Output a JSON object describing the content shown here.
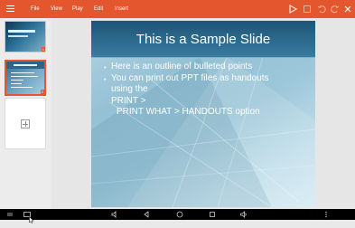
{
  "toolbar": {
    "menu_items": [
      "File",
      "View",
      "Play",
      "Edit",
      "Insert"
    ],
    "icons": [
      "menu-icon",
      "play-icon",
      "save-icon",
      "undo-icon",
      "redo-icon",
      "close-icon"
    ],
    "accent": "#e4562d"
  },
  "sidebar": {
    "thumbnails": [
      {
        "number": "1",
        "selected": false
      },
      {
        "number": "2",
        "selected": true
      }
    ],
    "add_slide_icon": "plus-icon"
  },
  "slide": {
    "title": "This is a Sample Slide",
    "bullets": [
      "Here is an outline of bulleted points",
      "You can print out PPT files as handouts",
      "using the",
      "PRINT >",
      "PRINT WHAT > HANDOUTS option"
    ]
  },
  "navbar": {
    "icons": [
      "keyboard-icon",
      "screenshot-icon",
      "volume-down-icon",
      "back-icon",
      "home-icon",
      "recents-icon",
      "volume-up-icon",
      "more-icon"
    ],
    "background": "#000000"
  }
}
